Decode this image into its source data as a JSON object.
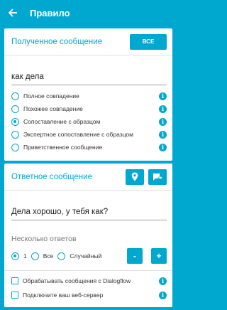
{
  "appbar": {
    "title": "Правило"
  },
  "received": {
    "header": "Полученное сообщение",
    "all_button": "ВСЕ",
    "input_value": "как дела",
    "options": [
      {
        "label": "Полное совпадение",
        "checked": false
      },
      {
        "label": "Похожее совпадение",
        "checked": false
      },
      {
        "label": "Сопоставление с образцом",
        "checked": true
      },
      {
        "label": "Экспертное сопоставление с образцом",
        "checked": false
      },
      {
        "label": "Приветственное сообщение",
        "checked": false
      }
    ]
  },
  "reply": {
    "header": "Ответное сообщение",
    "icons": [
      "location-pin-icon",
      "message-forward-icon"
    ],
    "input_value": "Дела хорошо, у тебя как?",
    "multi_label": "Несколько ответов",
    "multi_options": [
      {
        "label": "1",
        "checked": true
      },
      {
        "label": "Все",
        "checked": false
      },
      {
        "label": "Случайный",
        "checked": false
      }
    ],
    "minus_label": "-",
    "plus_label": "+",
    "checks": [
      {
        "label": "Обрабатывать сообщения с Dialogflow",
        "checked": false
      },
      {
        "label": "Подключите ваш веб-сервер",
        "checked": false
      }
    ]
  },
  "colors": {
    "accent": "#00a8d0"
  }
}
